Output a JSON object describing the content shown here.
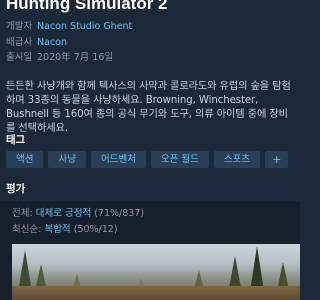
{
  "game": {
    "title": "Hunting Simulator 2"
  },
  "info": [
    {
      "key": "개발자",
      "value": "Nacon Studio Ghent",
      "link": true
    },
    {
      "key": "배급사",
      "value": "Nacon",
      "link": true
    },
    {
      "key": "출시일",
      "value": "2020年 7月 16일",
      "link": false
    }
  ],
  "description": "든든한 사냥개와 함께 텍사스의 사막과 콜로라도와 유럽의 숲을 탐험하며 33종의 동물을 사냥하세요. Browning, Winchester, Bushnell 등 160여 종의 공식 무기와 도구, 의류 아이템 중에 장비를 선택하세요.",
  "tags_heading": "태그",
  "tags": [
    "액션",
    "사냥",
    "어드벤처",
    "오픈 월드",
    "스포츠"
  ],
  "tags_more": "+",
  "reviews_heading": "평가",
  "reviews": [
    {
      "key": "전체:",
      "rating": "대체로 긍정적",
      "count": "(71%/837)"
    },
    {
      "key": "최신순:",
      "rating": "복합적",
      "count": "(50%/12)"
    }
  ],
  "colors": {
    "background": "#1b2838",
    "link": "#66c0f4",
    "tag_bg": "#2a3f55"
  }
}
